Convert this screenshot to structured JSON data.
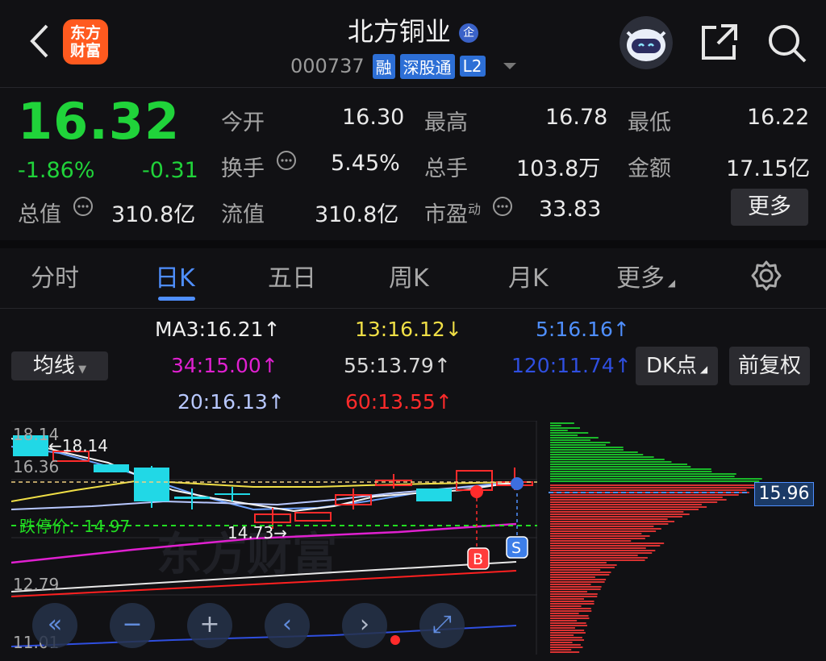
{
  "header": {
    "logo_line1": "东方",
    "logo_line2": "财富",
    "title": "北方铜业",
    "title_badge": "企",
    "code": "000737",
    "tags": [
      "融",
      "深股通",
      "L2"
    ]
  },
  "quote": {
    "price": "16.32",
    "change_pct": "-1.86%",
    "change": "-0.31",
    "open_label": "今开",
    "open": "16.30",
    "high_label": "最高",
    "high": "16.78",
    "low_label": "最低",
    "low": "16.22",
    "turnover_label": "换手",
    "turnover": "5.45%",
    "volume_label": "总手",
    "volume": "103.8万",
    "amount_label": "金额",
    "amount": "17.15亿",
    "mktcap_label": "总值",
    "mktcap": "310.8亿",
    "float_label": "流值",
    "float": "310.8亿",
    "pe_label": "市盈",
    "pe_sup": "动",
    "pe": "33.83",
    "more": "更多"
  },
  "tabs": [
    "分时",
    "日K",
    "五日",
    "周K",
    "月K",
    "更多"
  ],
  "ma": {
    "ma_select": "均线",
    "ma3": "MA3:16.21",
    "ma13": "13:16.12",
    "ma5": "5:16.16",
    "ma34": "34:15.00",
    "ma55": "55:13.79",
    "ma120": "120:11.74",
    "ma20": "20:16.13",
    "ma60": "60:13.55",
    "dk_btn": "DK点",
    "fq_btn": "前复权"
  },
  "chart": {
    "y_top": "18.14",
    "y_upper": "16.36",
    "y_lower": "12.79",
    "y_bottom": "11.01",
    "high_mark": "←18.14",
    "low_mark": "14.73→",
    "limit_down": "跌停价：14.97",
    "b_mark": "B",
    "s_mark": "S",
    "cursor_price": "15.96",
    "watermark": "东方财富"
  },
  "colors": {
    "up": "#ff2b2b",
    "down": "#20d33a",
    "accent": "#4f8fff"
  }
}
